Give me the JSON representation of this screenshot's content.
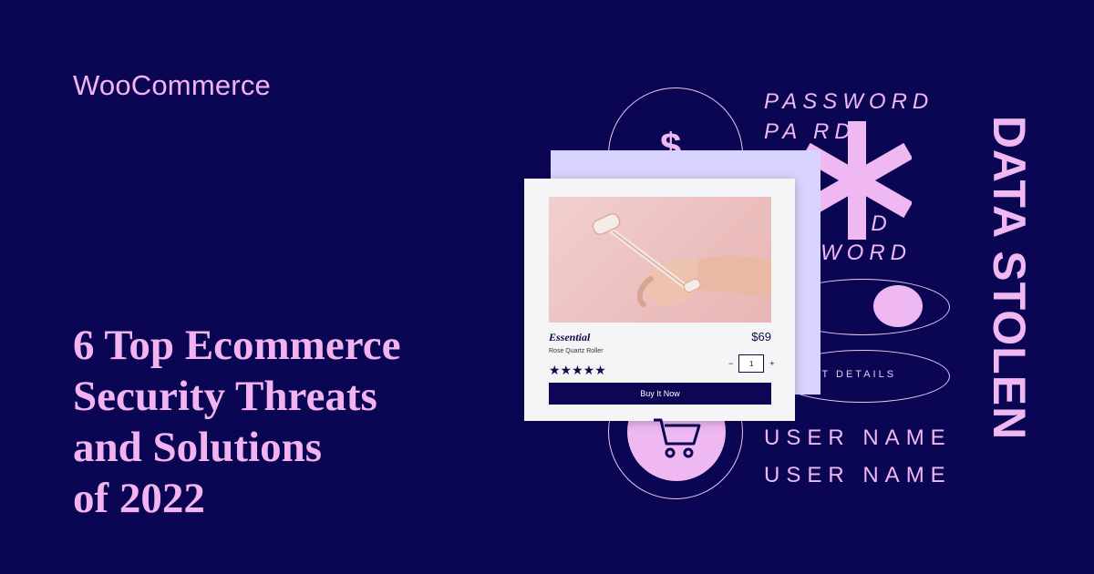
{
  "brand": {
    "name": "WooCommerce"
  },
  "headline": {
    "lines": [
      "6 Top Ecommerce",
      "Security Threats",
      "and Solutions",
      "of 2022"
    ]
  },
  "graphic": {
    "currency_symbol": "$",
    "password_words": [
      "PASSWORD",
      "PA    RD",
      "      D",
      "      D",
      "     RD",
      "  SWORD"
    ],
    "payment_text": "MENT DETAILS",
    "username_words": [
      "USER NAME",
      "USER NAME"
    ],
    "vertical_text": "DATA STOLEN",
    "accent_color": "#f0b8f3",
    "background_color": "#0b0654"
  },
  "product_card": {
    "name": "Essential",
    "subtitle": "Rose Quartz Roller",
    "price": "$69",
    "rating": 5,
    "stars": "★★★★★",
    "quantity": "1",
    "minus": "−",
    "plus": "+",
    "button_label": "Buy It Now"
  }
}
